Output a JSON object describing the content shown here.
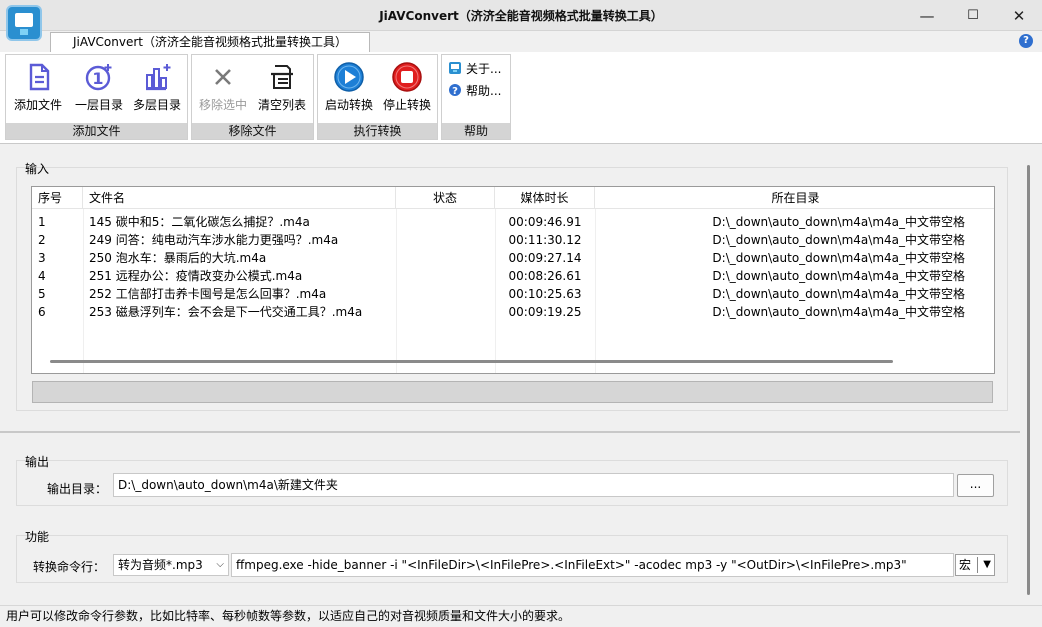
{
  "window": {
    "title": "JiAVConvert（济济全能音视频格式批量转换工具）",
    "minimize": "—",
    "maximize": "☐",
    "close": "✕"
  },
  "ribbon": {
    "tab_label": "JiAVConvert（济济全能音视频格式批量转换工具）",
    "help_icon": "?",
    "groups": {
      "add": {
        "caption": "添加文件",
        "add_file": "添加文件",
        "single_dir": "一层目录",
        "multi_dir": "多层目录"
      },
      "remove": {
        "caption": "移除文件",
        "remove_selected": "移除选中",
        "clear_list": "清空列表"
      },
      "run": {
        "caption": "执行转换",
        "start": "启动转换",
        "stop": "停止转换"
      },
      "help": {
        "caption": "帮助",
        "about": "关于...",
        "help": "帮助..."
      }
    }
  },
  "input": {
    "section_title": "输入",
    "columns": {
      "index": "序号",
      "filename": "文件名",
      "status": "状态",
      "duration": "媒体时长",
      "directory": "所在目录"
    },
    "rows": [
      {
        "index": "1",
        "filename": "145  碳中和5：二氧化碳怎么捕捉？.m4a",
        "status": "",
        "duration": "00:09:46.91",
        "directory": "D:\\_down\\auto_down\\m4a\\m4a_中文带空格"
      },
      {
        "index": "2",
        "filename": "249  问答：纯电动汽车涉水能力更强吗？.m4a",
        "status": "",
        "duration": "00:11:30.12",
        "directory": "D:\\_down\\auto_down\\m4a\\m4a_中文带空格"
      },
      {
        "index": "3",
        "filename": "250  泡水车：暴雨后的大坑.m4a",
        "status": "",
        "duration": "00:09:27.14",
        "directory": "D:\\_down\\auto_down\\m4a\\m4a_中文带空格"
      },
      {
        "index": "4",
        "filename": "251  远程办公：疫情改变办公模式.m4a",
        "status": "",
        "duration": "00:08:26.61",
        "directory": "D:\\_down\\auto_down\\m4a\\m4a_中文带空格"
      },
      {
        "index": "5",
        "filename": "252  工信部打击养卡囤号是怎么回事？.m4a",
        "status": "",
        "duration": "00:10:25.63",
        "directory": "D:\\_down\\auto_down\\m4a\\m4a_中文带空格"
      },
      {
        "index": "6",
        "filename": "253  磁悬浮列车：会不会是下一代交通工具？.m4a",
        "status": "",
        "duration": "00:09:19.25",
        "directory": "D:\\_down\\auto_down\\m4a\\m4a_中文带空格"
      }
    ]
  },
  "output": {
    "section_title": "输出",
    "dir_label": "输出目录：",
    "dir_value": "D:\\_down\\auto_down\\m4a\\新建文件夹",
    "browse_label": "..."
  },
  "function": {
    "section_title": "功能",
    "cmd_label": "转换命令行：",
    "preset_value": "转为音频*.mp3",
    "command_value": "ffmpeg.exe -hide_banner -i \"<InFileDir>\\<InFilePre>.<InFileExt>\" -acodec mp3 -y \"<OutDir>\\<InFilePre>.mp3\"",
    "macro_label": "宏"
  },
  "statusbar": {
    "text": "用户可以修改命令行参数，比如比特率、每秒帧数等参数，以适应自己的对音视频质量和文件大小的要求。"
  },
  "colors": {
    "accent_blue": "#1d7fd6",
    "stop_red": "#e01e1e",
    "icon_purple": "#5b5bd6"
  }
}
